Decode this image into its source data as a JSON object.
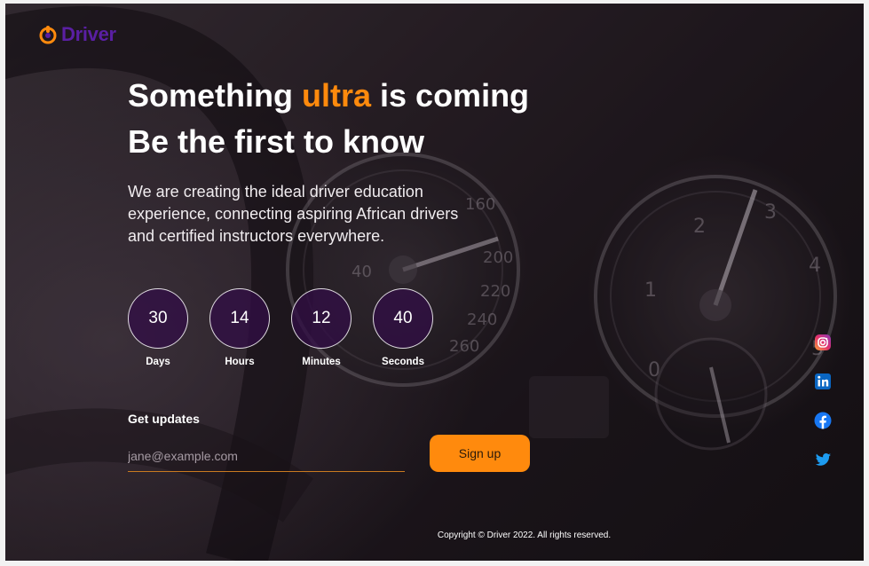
{
  "brand": {
    "name": "Driver",
    "color": "#5a1fa3",
    "accent": "#ff8a0d"
  },
  "hero": {
    "line1_before": "Something ",
    "line1_accent": "ultra",
    "line1_after": " is coming",
    "line2": "Be the first to know",
    "description": "We are creating the ideal driver education experience, connecting aspiring African drivers and certified instructors everywhere."
  },
  "countdown": [
    {
      "value": "30",
      "label": "Days"
    },
    {
      "value": "14",
      "label": "Hours"
    },
    {
      "value": "12",
      "label": "Minutes"
    },
    {
      "value": "40",
      "label": "Seconds"
    }
  ],
  "signup": {
    "label": "Get updates",
    "email_placeholder": "jane@example.com",
    "email_value": "",
    "button_label": "Sign up"
  },
  "social": [
    {
      "name": "instagram-icon"
    },
    {
      "name": "linkedin-icon"
    },
    {
      "name": "facebook-icon"
    },
    {
      "name": "twitter-icon"
    }
  ],
  "footer": {
    "copyright": "Copyright © Driver 2022. All rights reserved."
  }
}
